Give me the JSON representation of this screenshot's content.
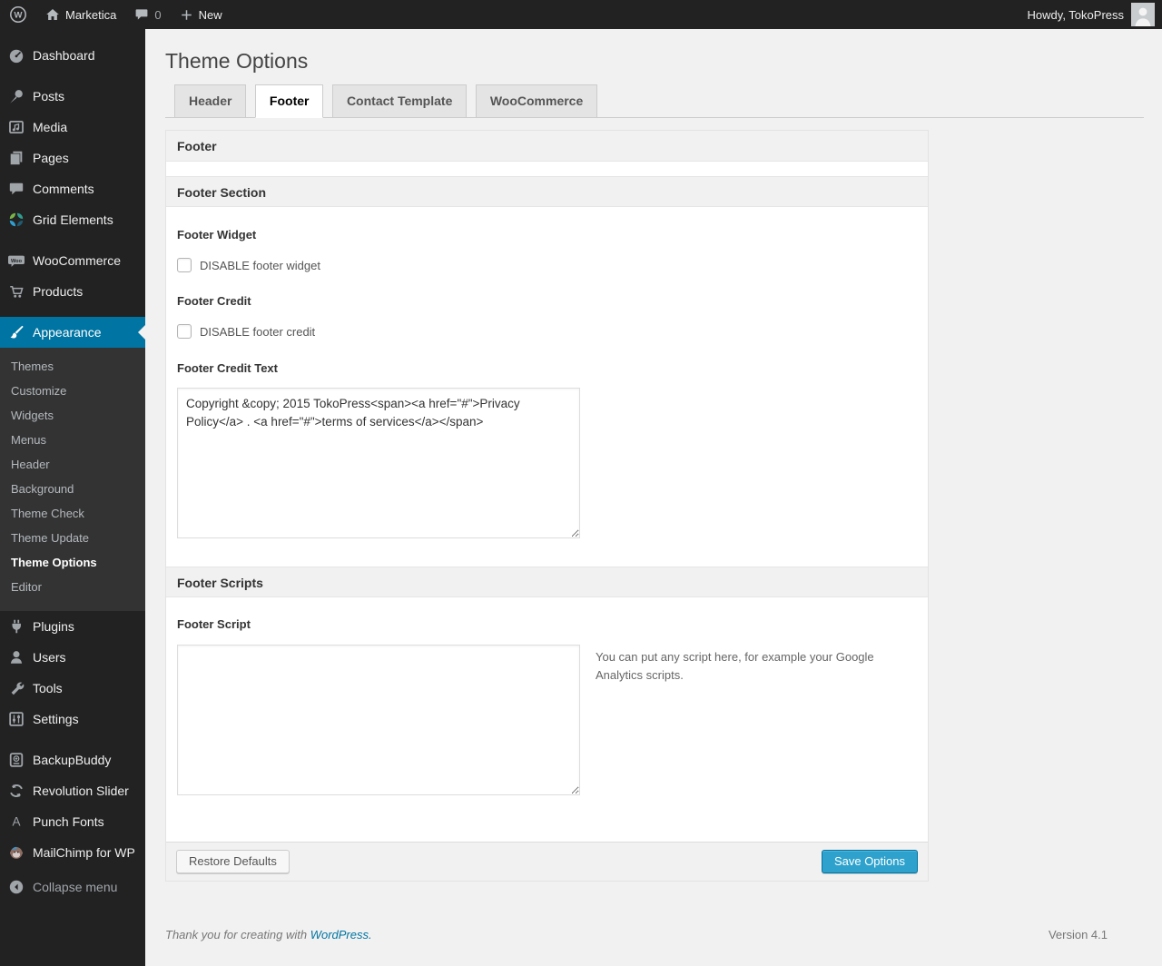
{
  "admin_bar": {
    "site_name": "Marketica",
    "comments_count": "0",
    "new_label": "New",
    "howdy_text": "Howdy, TokoPress"
  },
  "sidebar": {
    "items": [
      {
        "label": "Dashboard",
        "icon": "dashboard-icon"
      },
      {
        "label": "Posts",
        "icon": "pin-icon"
      },
      {
        "label": "Media",
        "icon": "media-icon"
      },
      {
        "label": "Pages",
        "icon": "pages-icon"
      },
      {
        "label": "Comments",
        "icon": "comment-icon"
      },
      {
        "label": "Grid Elements",
        "icon": "grid-icon"
      },
      {
        "label": "WooCommerce",
        "icon": "woocommerce-icon"
      },
      {
        "label": "Products",
        "icon": "cart-icon"
      },
      {
        "label": "Appearance",
        "icon": "brush-icon",
        "active": true
      },
      {
        "label": "Plugins",
        "icon": "plug-icon"
      },
      {
        "label": "Users",
        "icon": "user-icon"
      },
      {
        "label": "Tools",
        "icon": "wrench-icon"
      },
      {
        "label": "Settings",
        "icon": "sliders-icon"
      },
      {
        "label": "BackupBuddy",
        "icon": "backup-icon"
      },
      {
        "label": "Revolution Slider",
        "icon": "rotate-icon"
      },
      {
        "label": "Punch Fonts",
        "icon": "letter-a-icon"
      },
      {
        "label": "MailChimp for WP",
        "icon": "mailchimp-icon"
      }
    ],
    "appearance_submenu": [
      {
        "label": "Themes"
      },
      {
        "label": "Customize"
      },
      {
        "label": "Widgets"
      },
      {
        "label": "Menus"
      },
      {
        "label": "Header"
      },
      {
        "label": "Background"
      },
      {
        "label": "Theme Check"
      },
      {
        "label": "Theme Update"
      },
      {
        "label": "Theme Options",
        "current": true
      },
      {
        "label": "Editor"
      }
    ],
    "collapse_label": "Collapse menu"
  },
  "main": {
    "title": "Theme Options",
    "tabs": [
      {
        "label": "Header",
        "active": false
      },
      {
        "label": "Footer",
        "active": true
      },
      {
        "label": "Contact Template",
        "active": false
      },
      {
        "label": "WooCommerce",
        "active": false
      }
    ]
  },
  "panel": {
    "group_title": "Footer",
    "section1_title": "Footer Section",
    "footer_widget": {
      "label": "Footer Widget",
      "checkbox_label": "DISABLE footer widget",
      "checked": false
    },
    "footer_credit": {
      "label": "Footer Credit",
      "checkbox_label": "DISABLE footer credit",
      "checked": false
    },
    "footer_credit_text": {
      "label": "Footer Credit Text",
      "value": "Copyright &copy; 2015 TokoPress<span><a href=\"#\">Privacy Policy</a> . <a href=\"#\">terms of services</a></span>"
    },
    "section2_title": "Footer Scripts",
    "footer_script": {
      "label": "Footer Script",
      "value": "",
      "help": "You can put any script here, for example your Google Analytics scripts."
    },
    "restore_button_label": "Restore Defaults",
    "save_button_label": "Save Options"
  },
  "page_footer": {
    "thanks_text": "Thank you for creating with",
    "wordpress_link_label": "WordPress.",
    "version": "Version 4.1"
  },
  "colors": {
    "accent": "#0074a2",
    "primary_button": "#2ea2cc",
    "menu_bg": "#222222",
    "submenu_bg": "#333333",
    "page_bg": "#f1f1f1",
    "section_bar_bg": "#f1f1f1"
  }
}
